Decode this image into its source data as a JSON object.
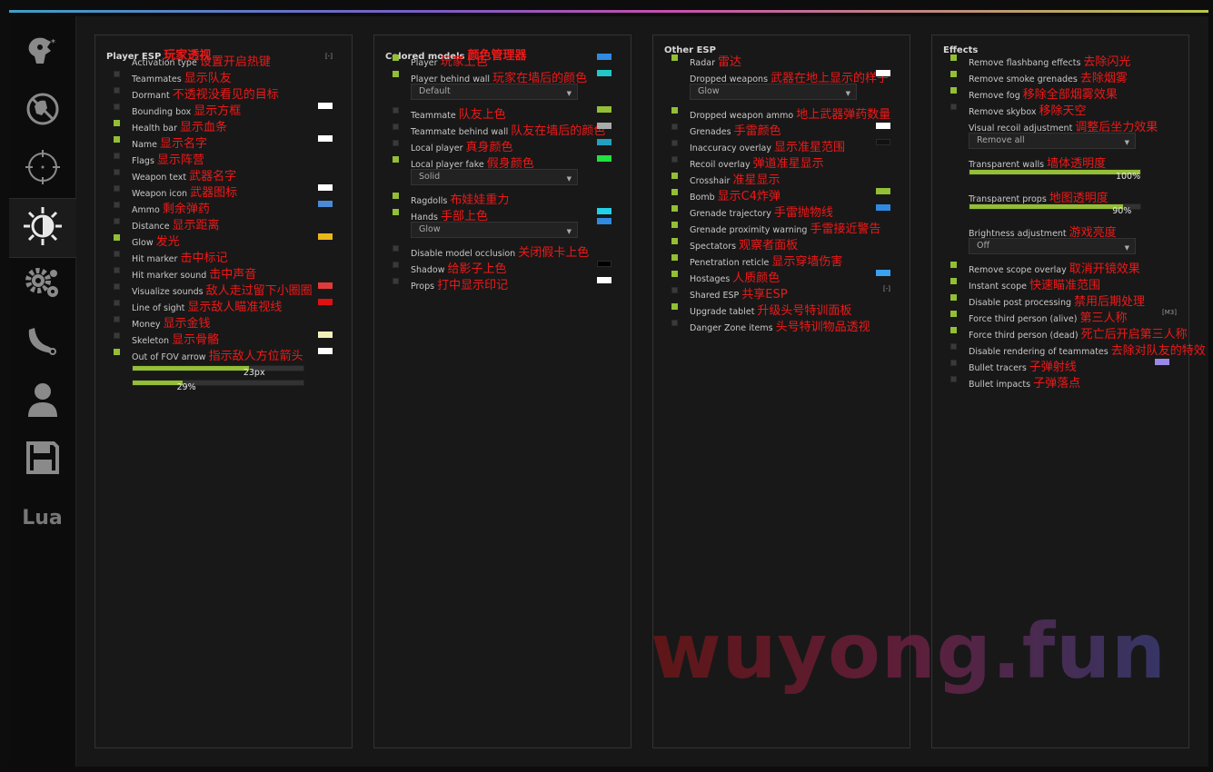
{
  "sidebar": {
    "tabs": [
      {
        "icon": "rage-head-icon"
      },
      {
        "icon": "legit-crossed-icon"
      },
      {
        "icon": "crosshair-icon"
      },
      {
        "icon": "visuals-contrast-icon",
        "active": true
      },
      {
        "icon": "gears-icon"
      },
      {
        "icon": "knife-icon"
      },
      {
        "icon": "player-icon"
      },
      {
        "icon": "save-disk-icon"
      },
      {
        "icon": "lua-text",
        "label": "Lua"
      }
    ]
  },
  "panels": {
    "player_esp": {
      "title": "Player ESP",
      "title_cn": "玩家透视",
      "rows": [
        {
          "label": "Activation type",
          "cn": "设置开启热键",
          "checkbox": null,
          "key": "[-]"
        },
        {
          "label": "Teammates",
          "cn": "显示队友",
          "checkbox": false
        },
        {
          "label": "Dormant",
          "cn": "不透视没看见的目标",
          "checkbox": false
        },
        {
          "label": "Bounding box",
          "cn": "显示方框",
          "checkbox": false,
          "color": "#ffffff"
        },
        {
          "label": "Health bar",
          "cn": "显示血条",
          "checkbox": true
        },
        {
          "label": "Name",
          "cn": "显示名字",
          "checkbox": true,
          "color": "#ffffff"
        },
        {
          "label": "Flags",
          "cn": "显示阵营",
          "checkbox": false
        },
        {
          "label": "Weapon text",
          "cn": "武器名字",
          "checkbox": false
        },
        {
          "label": "Weapon icon",
          "cn": "武器图标",
          "checkbox": false,
          "color": "#ffffff"
        },
        {
          "label": "Ammo",
          "cn": "剩余弹药",
          "checkbox": false,
          "color": "#4a8ad6"
        },
        {
          "label": "Distance",
          "cn": "显示距离",
          "checkbox": false
        },
        {
          "label": "Glow",
          "cn": "发光",
          "checkbox": true,
          "color": "#e8b81a"
        },
        {
          "label": "Hit marker",
          "cn": "击中标记",
          "checkbox": false
        },
        {
          "label": "Hit marker sound",
          "cn": "击中声音",
          "checkbox": false
        },
        {
          "label": "Visualize sounds",
          "cn": "敌人走过留下小圈圈",
          "checkbox": false,
          "color": "#e23a3a"
        },
        {
          "label": "Line of sight",
          "cn": "显示敌人瞄准视线",
          "checkbox": false,
          "color": "#e01010"
        },
        {
          "label": "Money",
          "cn": "显示金钱",
          "checkbox": false
        },
        {
          "label": "Skeleton",
          "cn": "显示骨骼",
          "checkbox": false,
          "color": "#f2f0b8"
        },
        {
          "label": "Out of FOV arrow",
          "cn": "指示敌人方位箭头",
          "checkbox": true,
          "color": "#ffffff"
        }
      ],
      "sliders": [
        {
          "value_text": "23px",
          "fraction": 0.68
        },
        {
          "value_text": "29%",
          "fraction": 0.29
        }
      ]
    },
    "colored_models": {
      "title": "Colored models",
      "title_cn": "颜色管理器",
      "rows": [
        {
          "label": "Player",
          "cn": "玩家上色",
          "checkbox": true,
          "color": "#2f8ae0"
        },
        {
          "label": "Player behind wall",
          "cn": "玩家在墙后的颜色",
          "checkbox": true,
          "color": "#22c8c8"
        },
        {
          "dropdown": "Default"
        },
        {
          "label": "Teammate",
          "cn": "队友上色",
          "checkbox": false,
          "color": "#93be35"
        },
        {
          "label": "Teammate behind wall",
          "cn": "队友在墙后的颜色",
          "checkbox": false,
          "color": "#aaaaaa"
        },
        {
          "label": "Local player",
          "cn": "真身颜色",
          "checkbox": false,
          "color": "#22a0c0"
        },
        {
          "label": "Local player fake",
          "cn": "假身颜色",
          "checkbox": true,
          "color": "#22e040"
        },
        {
          "dropdown": "Solid"
        },
        {
          "label": "Ragdolls",
          "cn": "布娃娃重力",
          "checkbox": true
        },
        {
          "label": "Hands",
          "cn": "手部上色",
          "checkbox": true,
          "color": "#22d0e8"
        },
        {
          "dropdown": "Glow",
          "color": "#2f8ae0"
        },
        {
          "label": "Disable model occlusion",
          "cn": "关闭假卡上色",
          "checkbox": false
        },
        {
          "label": "Shadow",
          "cn": "给影子上色",
          "checkbox": false,
          "color": "#000000"
        },
        {
          "label": "Props",
          "cn": "打中显示印记",
          "checkbox": false,
          "color": "#ffffff"
        }
      ]
    },
    "other_esp": {
      "title": "Other ESP",
      "rows": [
        {
          "label": "Radar",
          "cn": "雷达",
          "checkbox": true
        },
        {
          "label": "Dropped weapons",
          "cn": "武器在地上显示的样子",
          "checkbox": null,
          "color": "#ffffff"
        },
        {
          "dropdown": "Glow"
        },
        {
          "label": "Dropped weapon ammo",
          "cn": "地上武器弹药数量",
          "checkbox": true
        },
        {
          "label": "Grenades",
          "cn": "手雷颜色",
          "checkbox": false,
          "color": "#ffffff"
        },
        {
          "label": "Inaccuracy overlay",
          "cn": "显示准星范围",
          "checkbox": false,
          "color": "#111111"
        },
        {
          "label": "Recoil overlay",
          "cn": "弹道准星显示",
          "checkbox": false
        },
        {
          "label": "Crosshair",
          "cn": "准星显示",
          "checkbox": true
        },
        {
          "label": "Bomb",
          "cn": "显示C4炸弹",
          "checkbox": true,
          "color": "#93be35"
        },
        {
          "label": "Grenade trajectory",
          "cn": "手雷抛物线",
          "checkbox": true,
          "color": "#2f8ae0"
        },
        {
          "label": "Grenade proximity warning",
          "cn": "手雷接近警告",
          "checkbox": true
        },
        {
          "label": "Spectators",
          "cn": "观察者面板",
          "checkbox": true
        },
        {
          "label": "Penetration reticle",
          "cn": "显示穿墙伤害",
          "checkbox": true
        },
        {
          "label": "Hostages",
          "cn": "人质颜色",
          "checkbox": true,
          "color": "#3aa0f0"
        },
        {
          "label": "Shared ESP",
          "cn": "共享ESP",
          "checkbox": false,
          "key": "[-]"
        },
        {
          "label": "Upgrade tablet",
          "cn": "升级头号特训面板",
          "checkbox": true
        },
        {
          "label": "Danger Zone items",
          "cn": "头号特训物品透视",
          "checkbox": false
        }
      ]
    },
    "effects": {
      "title": "Effects",
      "rows": [
        {
          "label": "Remove flashbang effects",
          "cn": "去除闪光",
          "checkbox": true
        },
        {
          "label": "Remove smoke grenades",
          "cn": "去除烟雾",
          "checkbox": true
        },
        {
          "label": "Remove fog",
          "cn": "移除全部烟雾效果",
          "checkbox": true
        },
        {
          "label": "Remove skybox",
          "cn": "移除天空",
          "checkbox": false
        },
        {
          "label": "Visual recoil adjustment",
          "cn": "调整后坐力效果",
          "checkbox": null
        },
        {
          "dropdown": "Remove all"
        },
        {
          "label": "Transparent walls",
          "cn": "墙体透明度",
          "checkbox": null
        },
        {
          "slider": "100%",
          "fraction": 1.0
        },
        {
          "label": "Transparent props",
          "cn": "地图透明度",
          "checkbox": null
        },
        {
          "slider": "90%",
          "fraction": 0.9
        },
        {
          "label": "Brightness adjustment",
          "cn": "游戏亮度",
          "checkbox": null
        },
        {
          "dropdown": "Off"
        },
        {
          "label": "Remove scope overlay",
          "cn": "取消开镜效果",
          "checkbox": true
        },
        {
          "label": "Instant scope",
          "cn": "快速瞄准范围",
          "checkbox": true
        },
        {
          "label": "Disable post processing",
          "cn": "禁用后期处理",
          "checkbox": true
        },
        {
          "label": "Force third person (alive)",
          "cn": "第三人称",
          "checkbox": true,
          "key": "[M3]"
        },
        {
          "label": "Force third person (dead)",
          "cn": "死亡后开启第三人称",
          "checkbox": true
        },
        {
          "label": "Disable rendering of teammates",
          "cn": "去除对队友的特效",
          "checkbox": false
        },
        {
          "label": "Bullet tracers",
          "cn": "子弹射线",
          "checkbox": false,
          "color": "#9a88e8"
        },
        {
          "label": "Bullet impacts",
          "cn": "子弹落点",
          "checkbox": false
        }
      ]
    }
  },
  "watermark": "wuyong.fun"
}
